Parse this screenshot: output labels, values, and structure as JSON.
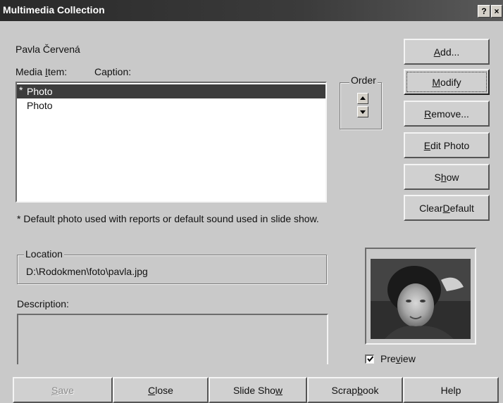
{
  "window": {
    "title": "Multimedia Collection",
    "help_btn": "?",
    "close_btn": "×"
  },
  "person_name": "Pavla Červená",
  "list": {
    "media_item_header": "Media Item:",
    "caption_header": "Caption:",
    "items": [
      {
        "marker": "*",
        "label": "Photo",
        "selected": true
      },
      {
        "marker": "",
        "label": "Photo",
        "selected": false
      }
    ]
  },
  "order": {
    "label": "Order"
  },
  "buttons": {
    "add": "Add...",
    "modify": "Modify",
    "remove": "Remove...",
    "edit_photo": "Edit Photo",
    "show": "Show",
    "clear_default": "Clear Default"
  },
  "footnote": "* Default photo used with reports or default sound used in slide show.",
  "location": {
    "label": "Location",
    "value": "D:\\Rodokmen\\foto\\pavla.jpg"
  },
  "description": {
    "label": "Description:",
    "value": ""
  },
  "preview": {
    "label": "Preview",
    "checked": true
  },
  "bottom_buttons": {
    "save": "Save",
    "close": "Close",
    "slide_show": "Slide Show",
    "scrapbook": "Scrapbook",
    "help": "Help"
  }
}
